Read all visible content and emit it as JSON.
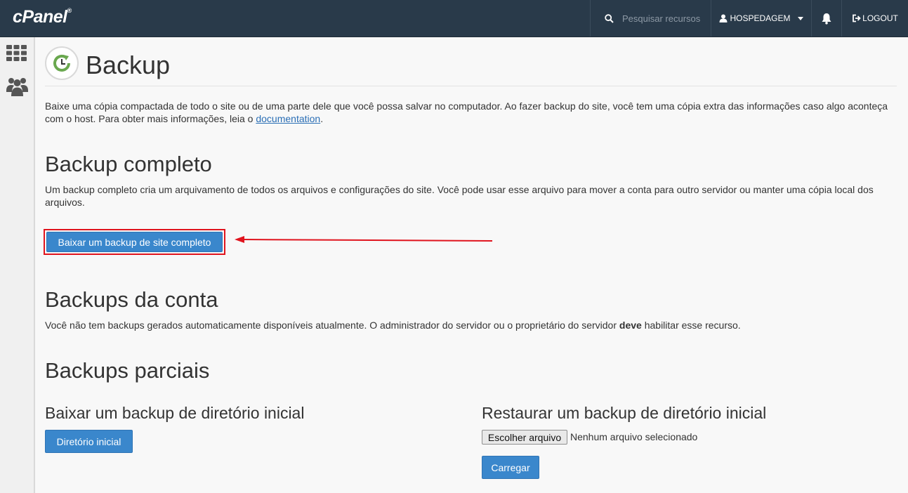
{
  "topbar": {
    "logo": "cPanel",
    "logo_mark": "®",
    "search_placeholder": "Pesquisar recursos",
    "user_label": "HOSPEDAGEM",
    "logout_label": "LOGOUT"
  },
  "page": {
    "title": "Backup",
    "intro_text": "Baixe uma cópia compactada de todo o site ou de uma parte dele que você possa salvar no computador. Ao fazer backup do site, você tem uma cópia extra das informações caso algo aconteça com o host. Para obter mais informações, leia o ",
    "intro_link": "documentation",
    "intro_end": "."
  },
  "full_backup": {
    "title": "Backup completo",
    "description": "Um backup completo cria um arquivamento de todos os arquivos e configurações do site. Você pode usar esse arquivo para mover a conta para outro servidor ou manter uma cópia local dos arquivos.",
    "button_label": "Baixar um backup de site completo"
  },
  "account_backups": {
    "title": "Backups da conta",
    "description_pre": "Você não tem backups gerados automaticamente disponíveis atualmente. O administrador do servidor ou o proprietário do servidor ",
    "description_bold": "deve",
    "description_post": " habilitar esse recurso."
  },
  "partial_backups": {
    "title": "Backups parciais",
    "download_title": "Baixar um backup de diretório inicial",
    "download_button": "Diretório inicial",
    "restore_title": "Restaurar um backup de diretório inicial",
    "choose_file_button": "Escolher arquivo",
    "no_file_text": "Nenhum arquivo selecionado",
    "upload_button": "Carregar"
  },
  "colors": {
    "topbar": "#293a4a",
    "primary_button": "#3a87cc",
    "highlight": "#e0141e"
  }
}
